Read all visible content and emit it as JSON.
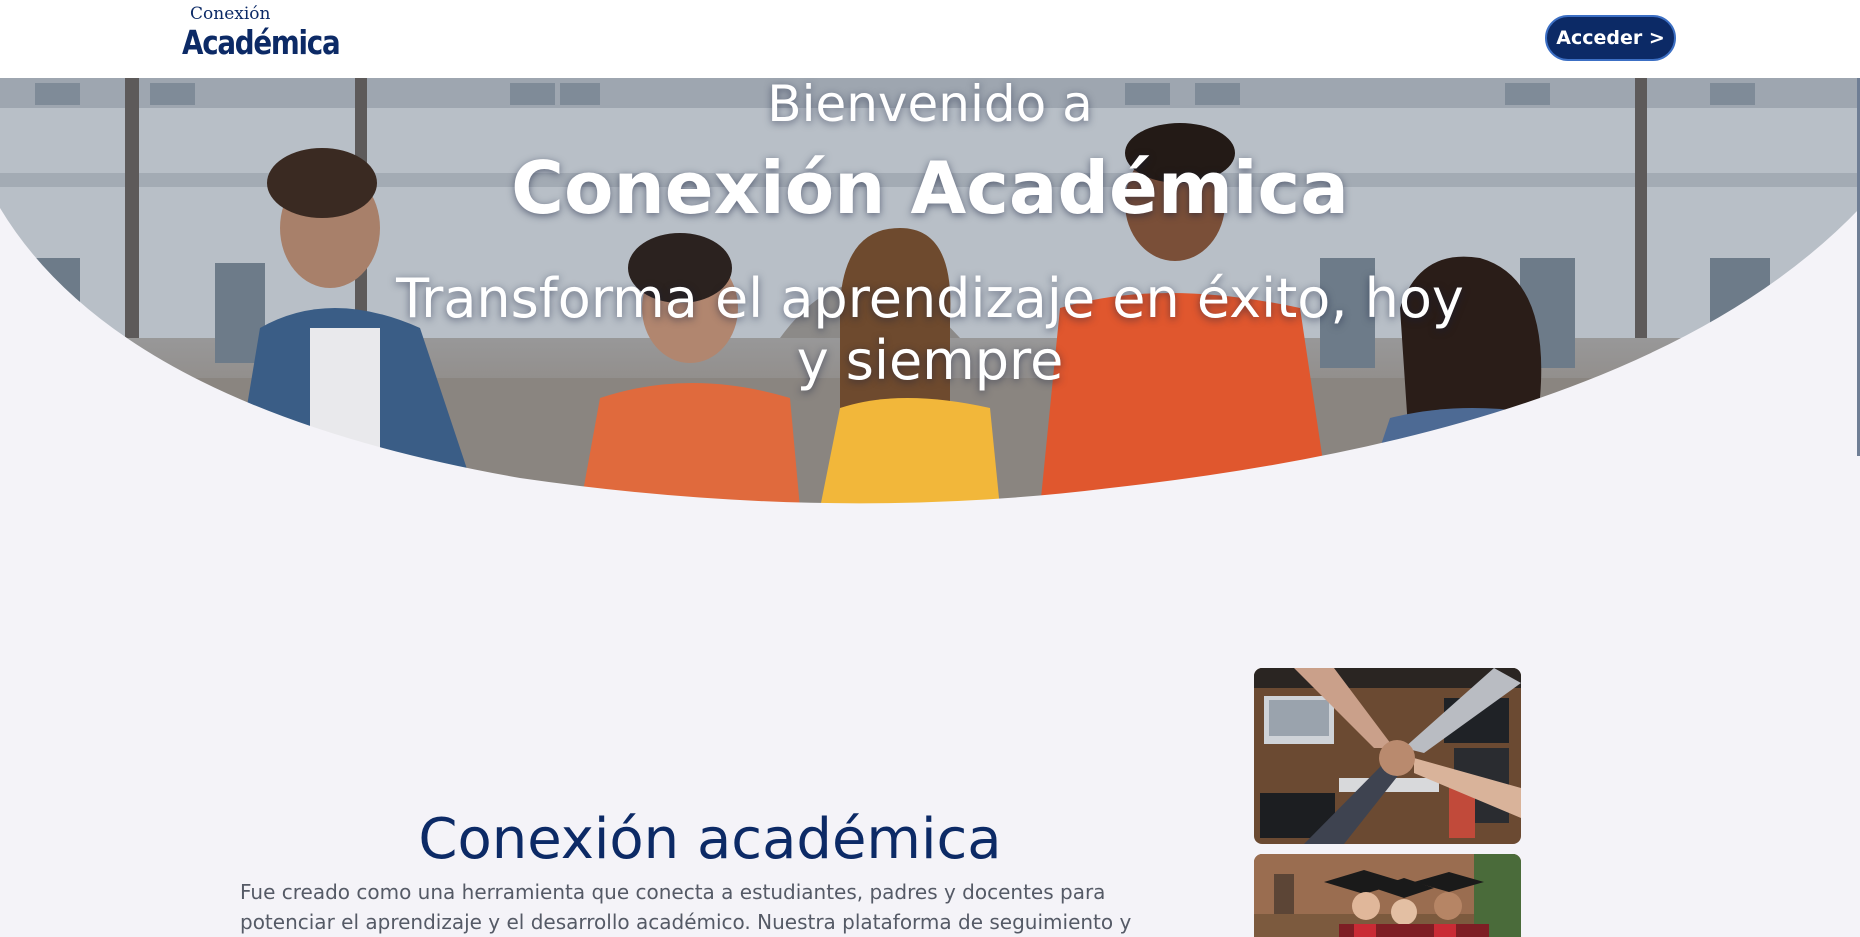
{
  "header": {
    "logo": {
      "top_word": "Conexión",
      "bottom_word": "Académica"
    },
    "login_button_label": "Acceder >"
  },
  "hero": {
    "welcome": "Bienvenido a",
    "title": "Conexión Académica",
    "tagline": "Transforma el aprendizaje en éxito, hoy y siempre"
  },
  "about": {
    "title": "Conexión académica",
    "text": "Fue creado como una herramienta que conecta a estudiantes, padres y docentes para potenciar el aprendizaje y el desarrollo académico. Nuestra plataforma de seguimiento y rendimiento escolar te"
  },
  "images": {
    "hero": "students-outdoors-photo",
    "team": "team-hands-together-photo",
    "grads": "graduates-photo"
  },
  "colors": {
    "brand": "#0c2a66",
    "page_background": "#f4f3f8",
    "header_background": "#ffffff",
    "body_text": "#555a66"
  }
}
